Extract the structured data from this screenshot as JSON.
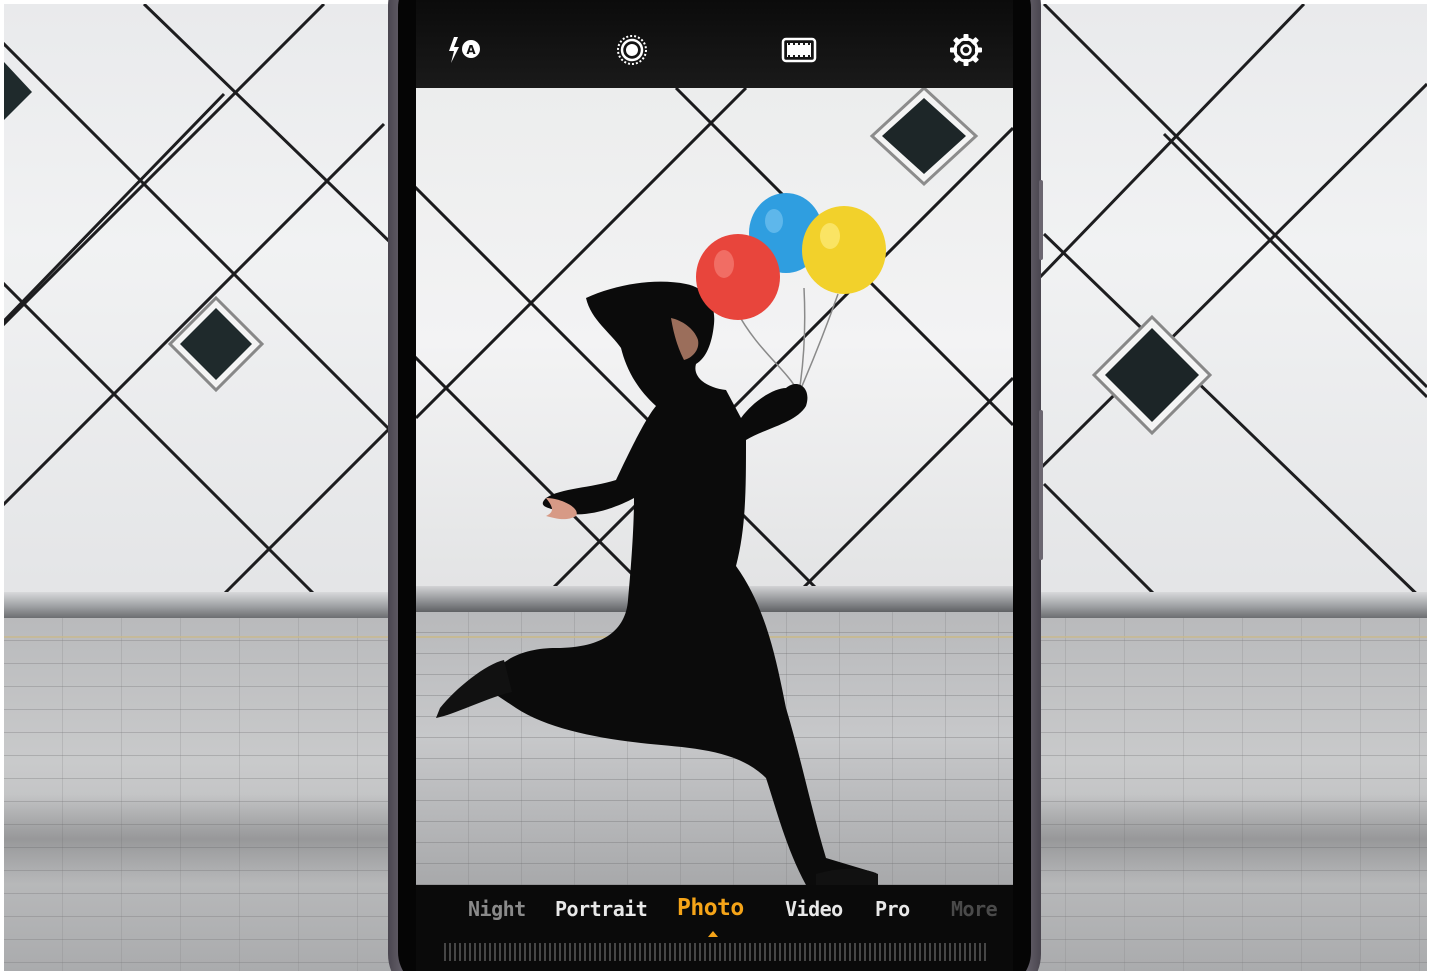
{
  "camera_app": {
    "top_bar": {
      "icons": [
        "flash-auto-icon",
        "live-photo-icon",
        "aspect-ratio-icon",
        "settings-icon"
      ],
      "flash_label": "A"
    },
    "modes": [
      {
        "label": "Night",
        "state": "dim"
      },
      {
        "label": "Portrait",
        "state": "normal"
      },
      {
        "label": "Photo",
        "state": "active"
      },
      {
        "label": "Video",
        "state": "normal"
      },
      {
        "label": "Pro",
        "state": "normal"
      },
      {
        "label": "More",
        "state": "faded"
      }
    ],
    "selected_mode": "Photo",
    "accent_color": "#f5a418",
    "balloon_colors": [
      "#e8453c",
      "#2f9ee0",
      "#f2d12b"
    ]
  }
}
